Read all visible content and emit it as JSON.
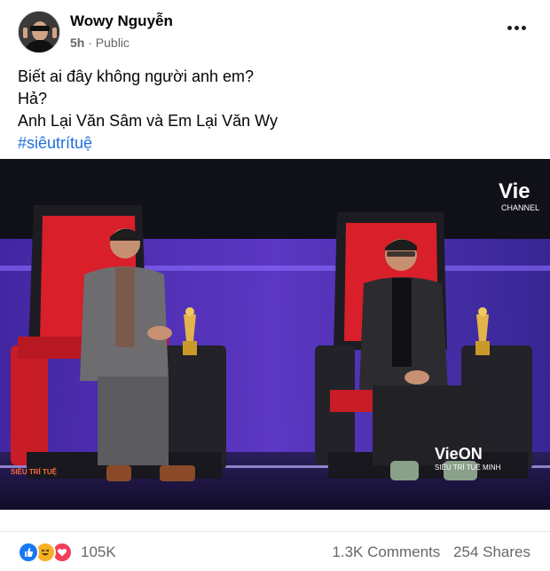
{
  "post": {
    "author": "Wowy Nguyễn",
    "time": "5h",
    "separator": "·",
    "privacy": "Public",
    "text_lines": [
      "Biết ai đây không người anh em?",
      "Hả?",
      "Anh Lại Văn Sâm và Em Lại Văn Wy"
    ],
    "hashtag": "#siêutrítuệ",
    "image": {
      "channel_logo": "Vie",
      "channel_sub": "CHANNEL",
      "show_logo": "VieON",
      "show_sub": "SIÊU TRÍ TUỆ MINH",
      "corner_text": "SIÊU TRÍ TUỆ"
    }
  },
  "footer": {
    "reaction_icons": [
      "like-icon",
      "haha-icon",
      "love-icon"
    ],
    "reaction_count": "105K",
    "comments": "1.3K Comments",
    "shares": "254 Shares"
  },
  "colors": {
    "link": "#216fdb",
    "secondary_text": "#65676b",
    "like": "#1877f2",
    "haha": "#f7b125",
    "love": "#f33e58"
  }
}
